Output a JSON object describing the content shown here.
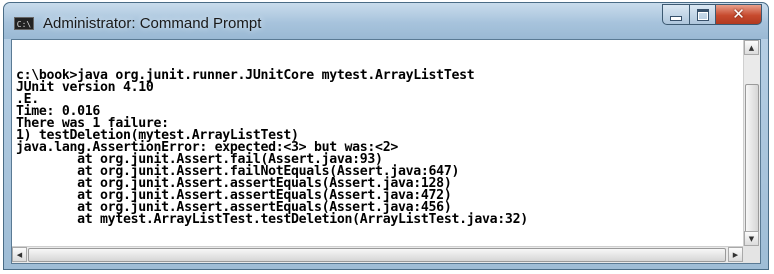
{
  "window": {
    "title": "Administrator: Command Prompt",
    "app_icon": "cmd-icon",
    "app_icon_text": "C:\\"
  },
  "controls": {
    "minimize": "minimize-icon",
    "maximize": "maximize-icon",
    "close": "close-icon",
    "close_glyph": "✕"
  },
  "console": {
    "lines": [
      "",
      "c:\\book>java org.junit.runner.JUnitCore mytest.ArrayListTest",
      "JUnit version 4.10",
      ".E.",
      "Time: 0.016",
      "There was 1 failure:",
      "1) testDeletion(mytest.ArrayListTest)",
      "java.lang.AssertionError: expected:<3> but was:<2>",
      "        at org.junit.Assert.fail(Assert.java:93)",
      "        at org.junit.Assert.failNotEquals(Assert.java:647)",
      "        at org.junit.Assert.assertEquals(Assert.java:128)",
      "        at org.junit.Assert.assertEquals(Assert.java:472)",
      "        at org.junit.Assert.assertEquals(Assert.java:456)",
      "        at mytest.ArrayListTest.testDeletion(ArrayListTest.java:32)"
    ]
  },
  "scrollbars": {
    "up_arrow": "▲",
    "down_arrow": "▼",
    "left_arrow": "◀",
    "right_arrow": "▶"
  },
  "colors": {
    "console_bg": "#ffffff",
    "console_text": "#000000",
    "titlebar": "#a7c3dc",
    "close_button": "#c74a2e"
  }
}
